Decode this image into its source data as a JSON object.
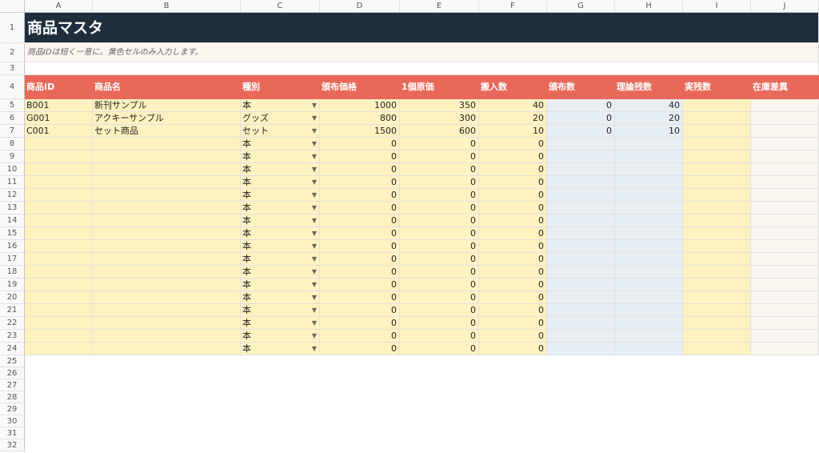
{
  "columns": [
    "A",
    "B",
    "C",
    "D",
    "E",
    "F",
    "G",
    "H",
    "I",
    "J"
  ],
  "title": "商品マスタ",
  "note": "商品IDは短く一意に。黄色セルのみ入力します。",
  "headers": [
    "商品ID",
    "商品名",
    "種別",
    "頒布価格",
    "1個原価",
    "搬入数",
    "頒布数",
    "理論残数",
    "実残数",
    "在庫差異"
  ],
  "dropdown_icon": "▼",
  "data_rows": [
    {
      "row": "5",
      "id": "B001",
      "name": "新刊サンプル",
      "type": "本",
      "price": "1000",
      "cost": "350",
      "stock_in": "40",
      "sold": "0",
      "theory": "40",
      "actual": "",
      "diff": ""
    },
    {
      "row": "6",
      "id": "G001",
      "name": "アクキーサンプル",
      "type": "グッズ",
      "price": "800",
      "cost": "300",
      "stock_in": "20",
      "sold": "0",
      "theory": "20",
      "actual": "",
      "diff": ""
    },
    {
      "row": "7",
      "id": "C001",
      "name": "セット商品",
      "type": "セット",
      "price": "1500",
      "cost": "600",
      "stock_in": "10",
      "sold": "0",
      "theory": "10",
      "actual": "",
      "diff": ""
    },
    {
      "row": "8",
      "id": "",
      "name": "",
      "type": "本",
      "price": "0",
      "cost": "0",
      "stock_in": "0",
      "sold": "",
      "theory": "",
      "actual": "",
      "diff": ""
    },
    {
      "row": "9",
      "id": "",
      "name": "",
      "type": "本",
      "price": "0",
      "cost": "0",
      "stock_in": "0",
      "sold": "",
      "theory": "",
      "actual": "",
      "diff": ""
    },
    {
      "row": "10",
      "id": "",
      "name": "",
      "type": "本",
      "price": "0",
      "cost": "0",
      "stock_in": "0",
      "sold": "",
      "theory": "",
      "actual": "",
      "diff": ""
    },
    {
      "row": "11",
      "id": "",
      "name": "",
      "type": "本",
      "price": "0",
      "cost": "0",
      "stock_in": "0",
      "sold": "",
      "theory": "",
      "actual": "",
      "diff": ""
    },
    {
      "row": "12",
      "id": "",
      "name": "",
      "type": "本",
      "price": "0",
      "cost": "0",
      "stock_in": "0",
      "sold": "",
      "theory": "",
      "actual": "",
      "diff": ""
    },
    {
      "row": "13",
      "id": "",
      "name": "",
      "type": "本",
      "price": "0",
      "cost": "0",
      "stock_in": "0",
      "sold": "",
      "theory": "",
      "actual": "",
      "diff": ""
    },
    {
      "row": "14",
      "id": "",
      "name": "",
      "type": "本",
      "price": "0",
      "cost": "0",
      "stock_in": "0",
      "sold": "",
      "theory": "",
      "actual": "",
      "diff": ""
    },
    {
      "row": "15",
      "id": "",
      "name": "",
      "type": "本",
      "price": "0",
      "cost": "0",
      "stock_in": "0",
      "sold": "",
      "theory": "",
      "actual": "",
      "diff": ""
    },
    {
      "row": "16",
      "id": "",
      "name": "",
      "type": "本",
      "price": "0",
      "cost": "0",
      "stock_in": "0",
      "sold": "",
      "theory": "",
      "actual": "",
      "diff": ""
    },
    {
      "row": "17",
      "id": "",
      "name": "",
      "type": "本",
      "price": "0",
      "cost": "0",
      "stock_in": "0",
      "sold": "",
      "theory": "",
      "actual": "",
      "diff": ""
    },
    {
      "row": "18",
      "id": "",
      "name": "",
      "type": "本",
      "price": "0",
      "cost": "0",
      "stock_in": "0",
      "sold": "",
      "theory": "",
      "actual": "",
      "diff": ""
    },
    {
      "row": "19",
      "id": "",
      "name": "",
      "type": "本",
      "price": "0",
      "cost": "0",
      "stock_in": "0",
      "sold": "",
      "theory": "",
      "actual": "",
      "diff": ""
    },
    {
      "row": "20",
      "id": "",
      "name": "",
      "type": "本",
      "price": "0",
      "cost": "0",
      "stock_in": "0",
      "sold": "",
      "theory": "",
      "actual": "",
      "diff": ""
    },
    {
      "row": "21",
      "id": "",
      "name": "",
      "type": "本",
      "price": "0",
      "cost": "0",
      "stock_in": "0",
      "sold": "",
      "theory": "",
      "actual": "",
      "diff": ""
    },
    {
      "row": "22",
      "id": "",
      "name": "",
      "type": "本",
      "price": "0",
      "cost": "0",
      "stock_in": "0",
      "sold": "",
      "theory": "",
      "actual": "",
      "diff": ""
    },
    {
      "row": "23",
      "id": "",
      "name": "",
      "type": "本",
      "price": "0",
      "cost": "0",
      "stock_in": "0",
      "sold": "",
      "theory": "",
      "actual": "",
      "diff": ""
    },
    {
      "row": "24",
      "id": "",
      "name": "",
      "type": "本",
      "price": "0",
      "cost": "0",
      "stock_in": "0",
      "sold": "",
      "theory": "",
      "actual": "",
      "diff": ""
    }
  ],
  "empty_row_numbers": [
    "25",
    "26",
    "27",
    "28",
    "29",
    "30",
    "31",
    "32"
  ],
  "colors": {
    "title_bg": "#1f2e3d",
    "header_bg": "#e8695a",
    "input_bg": "#fef2c0",
    "formula_bg": "#e8eff4",
    "note_bg": "#faf6ef"
  }
}
